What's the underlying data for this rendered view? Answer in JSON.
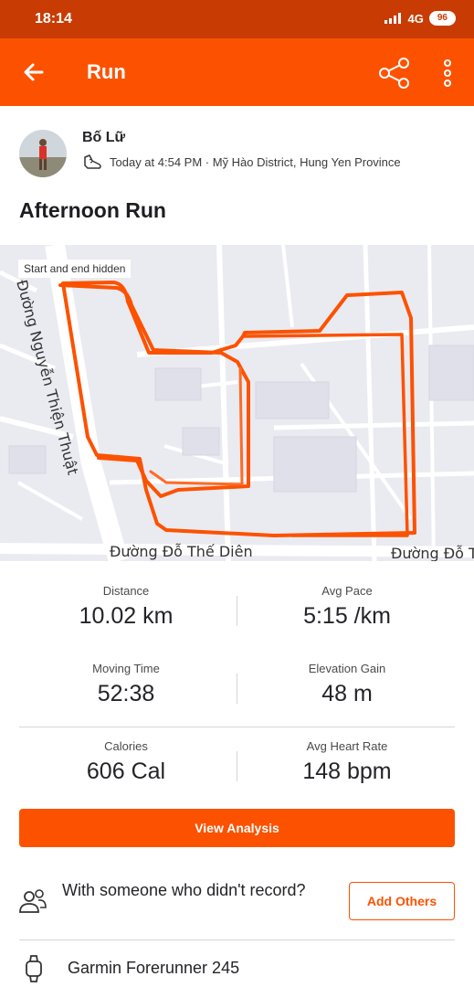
{
  "status_bar": {
    "time": "18:14",
    "network": "4G",
    "battery": "96"
  },
  "app_bar": {
    "title": "Run",
    "icons": [
      "back-arrow-icon",
      "share-icon",
      "more-vertical-icon"
    ]
  },
  "athlete": {
    "name": "Bố Lữ",
    "meta": "Today at 4:54 PM · Mỹ Hào District, Hung Yen Province"
  },
  "activity": {
    "title": "Afternoon Run"
  },
  "map": {
    "badge": "Start and end hidden",
    "street_1": "Đường Nguyễn Thiện Thuật",
    "street_2": "Đường Đỗ Thế Diên",
    "street_3": "Đường Đỗ T",
    "route_color": "#fc5200"
  },
  "stats": [
    {
      "label": "Distance",
      "value": "10.02 km"
    },
    {
      "label": "Avg Pace",
      "value": "5:15 /km"
    },
    {
      "label": "Moving Time",
      "value": "52:38"
    },
    {
      "label": "Elevation Gain",
      "value": "48 m"
    },
    {
      "label": "Calories",
      "value": "606 Cal"
    },
    {
      "label": "Avg Heart Rate",
      "value": "148 bpm"
    }
  ],
  "actions": {
    "view_analysis": "View Analysis",
    "with_someone": "With someone who didn't record?",
    "add_others": "Add Others"
  },
  "device": {
    "name": "Garmin Forerunner 245"
  },
  "colors": {
    "brand": "#fc5200",
    "status_bar": "#c83c04"
  }
}
